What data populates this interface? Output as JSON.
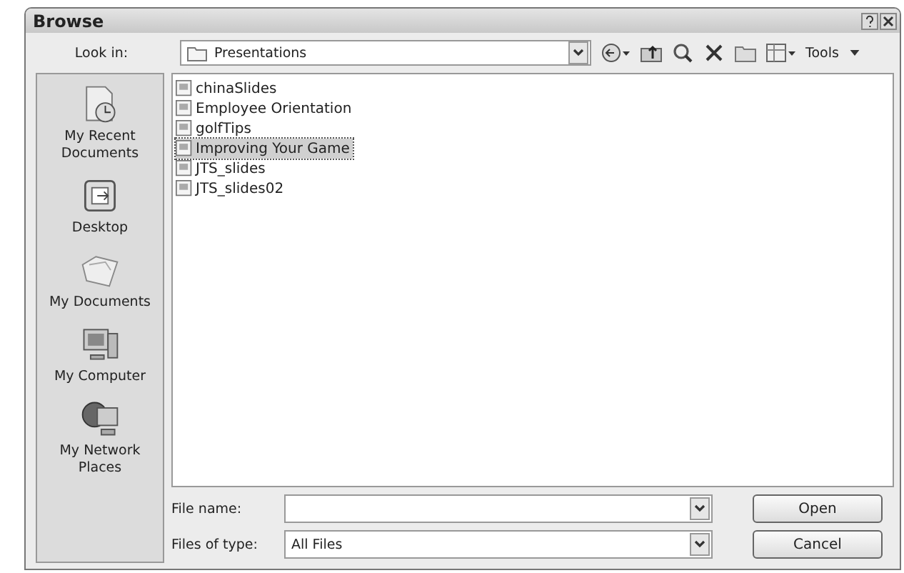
{
  "window": {
    "title": "Browse"
  },
  "look_in": {
    "label": "Look in:",
    "value": "Presentations"
  },
  "toolbar": {
    "tools_label": "Tools"
  },
  "places": [
    {
      "label": "My Recent Documents",
      "kind": "recent"
    },
    {
      "label": "Desktop",
      "kind": "desktop"
    },
    {
      "label": "My Documents",
      "kind": "documents"
    },
    {
      "label": "My Computer",
      "kind": "computer"
    },
    {
      "label": "My Network Places",
      "kind": "network"
    }
  ],
  "files": [
    {
      "name": "chinaSlides",
      "selected": false
    },
    {
      "name": "Employee Orientation",
      "selected": false
    },
    {
      "name": "golfTips",
      "selected": false
    },
    {
      "name": "Improving Your Game",
      "selected": true
    },
    {
      "name": "JTS_slides",
      "selected": false
    },
    {
      "name": "JTS_slides02",
      "selected": false
    }
  ],
  "file_name": {
    "label": "File name:"
  },
  "file_type": {
    "label": "Files of type:",
    "value": "All Files"
  },
  "buttons": [
    "Open",
    "Cancel"
  ]
}
